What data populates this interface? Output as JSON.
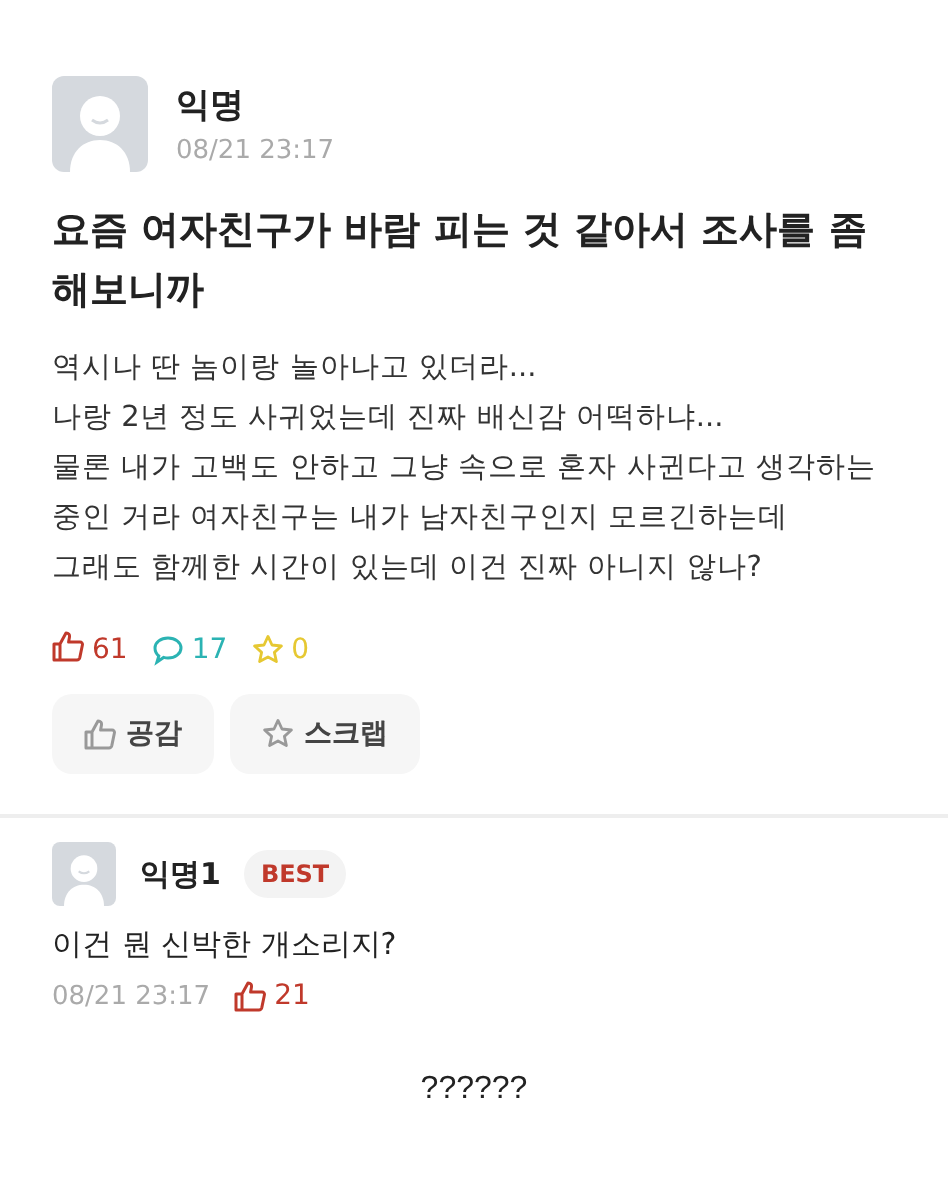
{
  "post": {
    "author": "익명",
    "time": "08/21 23:17",
    "title": "요즘 여자친구가 바람 피는 것 같아서 조사를 좀 해보니까",
    "body": [
      "역시나 딴 놈이랑 놀아나고 있더라...",
      "나랑 2년 정도 사귀었는데 진짜 배신감 어떡하냐...",
      "물론 내가 고백도 안하고 그냥 속으로 혼자 사귄다고 생각하는",
      "중인 거라 여자친구는 내가 남자친구인지 모르긴하는데",
      "그래도 함께한 시간이 있는데 이건 진짜 아니지 않나?"
    ],
    "stats": [
      {
        "kind": "like",
        "count": "61",
        "color": "#c0392b"
      },
      {
        "kind": "comment",
        "count": "17",
        "color": "#2bb3b3"
      },
      {
        "kind": "scrap",
        "count": "0",
        "color": "#e6c832"
      }
    ],
    "buttons": [
      {
        "kind": "like",
        "label": "공감"
      },
      {
        "kind": "scrap",
        "label": "스크랩"
      }
    ]
  },
  "comment": {
    "author": "익명1",
    "badge": "BEST",
    "text": "이건 뭔 신박한 개소리지?",
    "time": "08/21 23:17",
    "likes": "21"
  },
  "caption": "??????"
}
